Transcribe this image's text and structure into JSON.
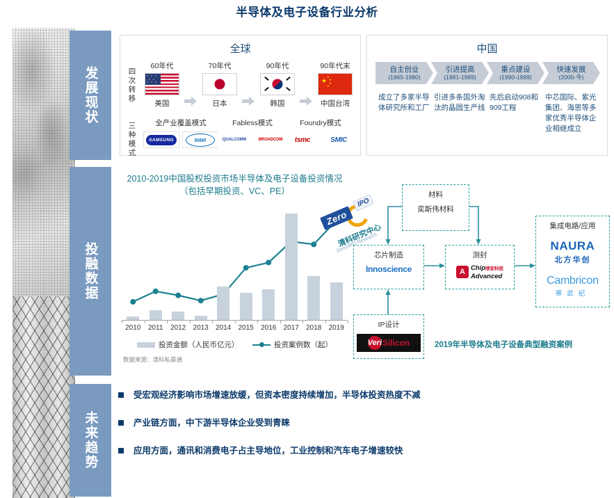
{
  "title": "半导体及电子设备行业分析",
  "sidebar": {
    "items": [
      {
        "label": "发展现状"
      },
      {
        "label": "投融数据"
      },
      {
        "label": "未来趋势"
      }
    ]
  },
  "global_panel": {
    "title": "全球",
    "row1_label": "四次转移",
    "row2_label": "三种模式",
    "transfers": [
      {
        "era": "60年代",
        "country": "美国",
        "flag": "us-flag-icon"
      },
      {
        "era": "70年代",
        "country": "日本",
        "flag": "jp-flag-icon"
      },
      {
        "era": "90年代",
        "country": "韩国",
        "flag": "kr-flag-icon"
      },
      {
        "era": "90年代末",
        "country": "中国台湾",
        "flag": "cn-flag-icon"
      }
    ],
    "modes": [
      {
        "title": "全产业覆盖模式",
        "logos": [
          "SAMSUNG",
          "intel"
        ]
      },
      {
        "title": "Fabless模式",
        "logos": [
          "QUALCOMM",
          "BROADCOM"
        ]
      },
      {
        "title": "Foundry模式",
        "logos": [
          "tsmc",
          "SMIC"
        ]
      }
    ]
  },
  "china_panel": {
    "title": "中国",
    "stages": [
      {
        "name": "自主创业",
        "years": "(1965-1980)",
        "desc": "成立了多家半导体研究所和工厂"
      },
      {
        "name": "引进提高",
        "years": "(1981-1989)",
        "desc": "引进多条国外淘汰的晶圆生产线"
      },
      {
        "name": "重点建设",
        "years": "(1990-1999)",
        "desc": "先后启动908和909工程"
      },
      {
        "name": "快速发展",
        "years": "(2000-今)",
        "desc": "中芯国际、紫光集团、海思等多家优秀半导体企业相继成立"
      }
    ]
  },
  "chart_data": {
    "type": "bar",
    "title": "2010-2019中国股权投资市场半导体及电子设备投资情况",
    "subtitle": "（包括早期投资、VC、PE）",
    "categories": [
      "2010",
      "2011",
      "2012",
      "2013",
      "2014",
      "2015",
      "2016",
      "2017",
      "2018",
      "2019"
    ],
    "xlabel": "",
    "ylabel": "",
    "grid": false,
    "legend_position": "bottom",
    "series": [
      {
        "name": "投资金额（人民币亿元）",
        "type": "bar",
        "color": "#c8d2dd",
        "values": [
          8,
          22,
          19,
          10,
          78,
          63,
          72,
          248,
          103,
          88
        ]
      },
      {
        "name": "投资案例数（起）",
        "type": "line",
        "color": "#1b8091",
        "values": [
          62,
          98,
          84,
          66,
          88,
          178,
          196,
          268,
          258,
          340
        ]
      }
    ],
    "source": "数据来源：清科私募通",
    "watermark": {
      "tag": "Zero",
      "ipo": "IPO",
      "cn": "清科研究中心",
      "en": "Zero2IPO Research"
    }
  },
  "flow": {
    "caption": "2019年半导体及电子设备典型融资案例",
    "nodes": [
      {
        "title": "材料",
        "logo_text": "奕斯伟材料"
      },
      {
        "title": "芯片制造",
        "logo_text": "Innoscience"
      },
      {
        "title": "测封",
        "logo_text": "Chip Advanced 颀安科技"
      },
      {
        "title": "集成电路/应用",
        "logo_text": "NAURA 北方华创 / Cambricon 寒武纪"
      },
      {
        "title": "IP设计",
        "logo_text": "VeriSilicon"
      }
    ],
    "logos": {
      "eswin": "奕斯伟材料",
      "innoscience": "Innoscience",
      "chip_t1": "Chip",
      "chip_t2": "Advanced",
      "chip_t3": "颀安科技",
      "naura_en": "NAURA",
      "naura_cn": "北方华创",
      "cambricon_en": "Cambricon",
      "cambricon_cn": "寒武纪",
      "veri_1": "Veri",
      "veri_2": "Silicon"
    }
  },
  "trends": {
    "bullets": [
      "受宏观经济影响市场增速放缓，但资本密度持续增加，半导体投资热度不减",
      "产业链方面，中下游半导体企业受到青睐",
      "应用方面，通讯和消费电子占主导地位，工业控制和汽车电子增速较快"
    ]
  },
  "colors": {
    "title": "#0c3a6b",
    "sidebar": "#7a9ac0",
    "teal": "#1b8091",
    "bar": "#c8d2dd",
    "chevron": "#c5ccd6",
    "chevron_text": "#1f4e79"
  }
}
